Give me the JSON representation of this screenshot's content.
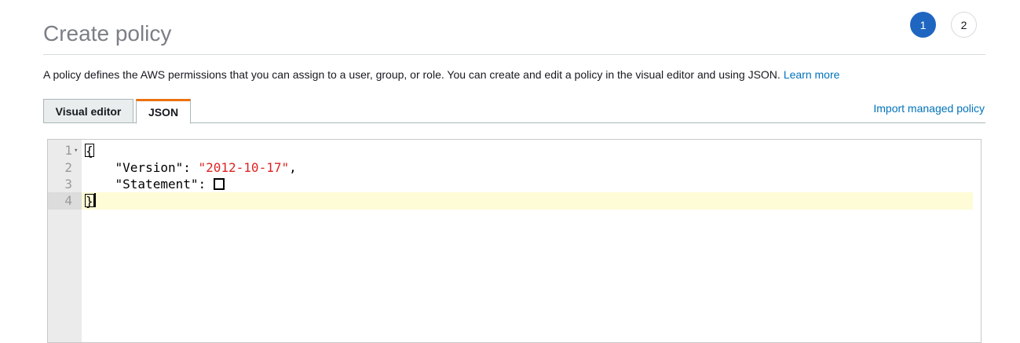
{
  "header": {
    "title": "Create policy",
    "steps": [
      "1",
      "2"
    ],
    "active_step": "1"
  },
  "description": {
    "text": "A policy defines the AWS permissions that you can assign to a user, group, or role. You can create and edit a policy in the visual editor and using JSON.",
    "learn_more": "Learn more"
  },
  "tabs": [
    {
      "label": "Visual editor",
      "active": false
    },
    {
      "label": "JSON",
      "active": true
    }
  ],
  "import_link": "Import managed policy",
  "editor": {
    "line_numbers": [
      "1",
      "2",
      "3",
      "4"
    ],
    "lines": [
      {
        "text": "{"
      },
      {
        "key": "\"Version\"",
        "sep": ": ",
        "value": "\"2012-10-17\"",
        "trail": ","
      },
      {
        "key": "\"Statement\"",
        "sep": ": "
      },
      {
        "text": "}"
      }
    ],
    "active_line": 4
  },
  "colors": {
    "accent": "#1f66c1",
    "tab_highlight": "#ec7211",
    "link": "#0073bb",
    "string": "#dd2424",
    "active_line_bg": "#fefcd7"
  }
}
